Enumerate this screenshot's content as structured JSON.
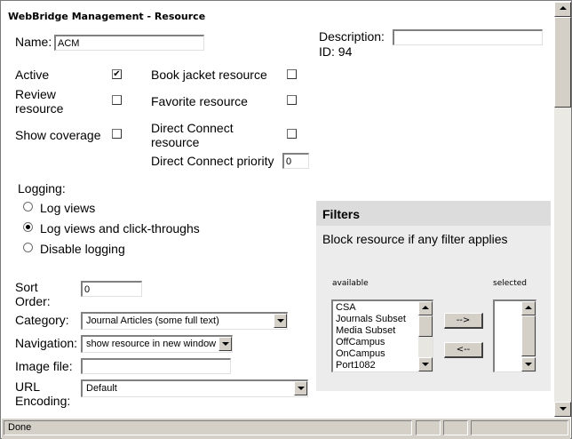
{
  "page": {
    "title": "WebBridge Management - Resource"
  },
  "form": {
    "name_label": "Name:",
    "name_value": "ACM",
    "description_label": "Description:",
    "description_value": "",
    "id_text": "ID: 94",
    "active_label": "Active",
    "active_checked": "✔",
    "book_jacket_label": "Book jacket resource",
    "review_label_1": "Review",
    "review_label_2": "resource",
    "favorite_label": "Favorite resource",
    "show_coverage_label": "Show coverage",
    "direct_connect_label_1": "Direct Connect",
    "direct_connect_label_2": "resource",
    "direct_connect_priority_label": "Direct Connect priority",
    "direct_connect_priority_value": "0"
  },
  "logging": {
    "label": "Logging:",
    "options": [
      "Log views",
      "Log views and click-throughs",
      "Disable logging"
    ],
    "selected_index": 1
  },
  "lower": {
    "sort_order_label_1": "Sort",
    "sort_order_label_2": "Order:",
    "sort_order_value": "0",
    "category_label": "Category:",
    "category_value": "Journal Articles (some full text)",
    "navigation_label": "Navigation:",
    "navigation_value": "show resource in new window",
    "image_file_label": "Image file:",
    "image_file_value": "",
    "url_encoding_label_1": "URL",
    "url_encoding_label_2": "Encoding:",
    "url_encoding_value": "Default"
  },
  "filters": {
    "heading": "Filters",
    "description": "Block resource if any filter applies",
    "available_label": "available",
    "selected_label": "selected",
    "available_items": [
      "CSA",
      "Journals Subset",
      "Media Subset",
      "OffCampus",
      "OnCampus",
      "Port1082"
    ],
    "selected_items": [],
    "add_button": "-->",
    "remove_button": "<--"
  },
  "status": {
    "text": "Done"
  }
}
